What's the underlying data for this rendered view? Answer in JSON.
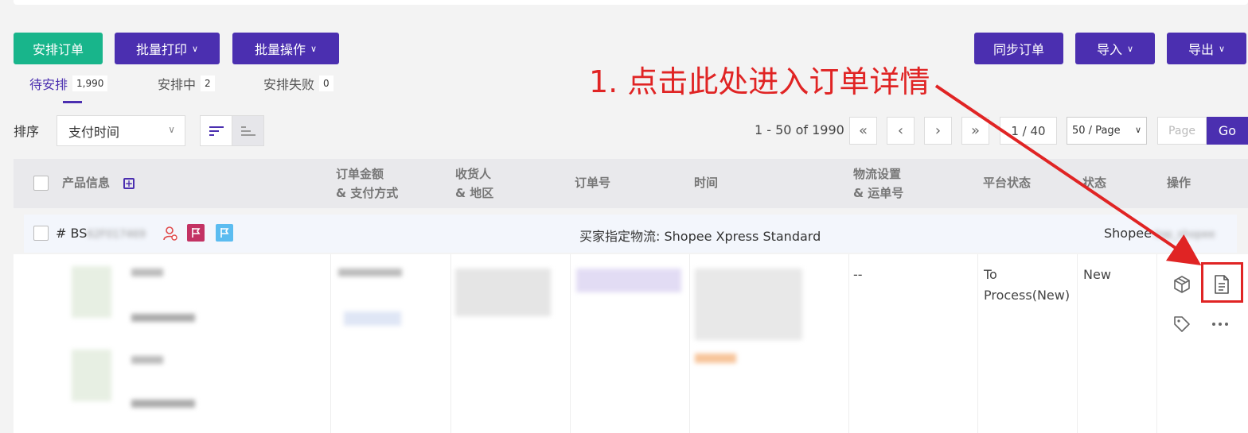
{
  "toolbar": {
    "arrange": "安排订单",
    "batch_print": "批量打印",
    "batch_ops": "批量操作",
    "sync": "同步订单",
    "import": "导入",
    "export": "导出"
  },
  "tabs": [
    {
      "label": "待安排",
      "count": "1,990"
    },
    {
      "label": "安排中",
      "count": "2"
    },
    {
      "label": "安排失败",
      "count": "0"
    }
  ],
  "sort": {
    "label": "排序",
    "value": "支付时间"
  },
  "pager": {
    "range": "1 - 50 of 1990",
    "current": "1 / 40",
    "page_size": "50 / Page",
    "page_placeholder": "Page",
    "go": "Go"
  },
  "table": {
    "headers": {
      "product": "产品信息",
      "amount_1": "订单金额",
      "amount_2": "& 支付方式",
      "receiver_1": "收货人",
      "receiver_2": "& 地区",
      "order_no": "订单号",
      "time": "时间",
      "logistics_1": "物流设置",
      "logistics_2": "& 运单号",
      "platform_status": "平台状态",
      "status": "状态",
      "actions": "操作"
    },
    "group": {
      "order_id": "# BS",
      "order_id_blurred": "62F017469",
      "logistics": "买家指定物流: Shopee Xpress Standard",
      "store": "Shopee",
      "store_blurred": "-top_shopee"
    },
    "row": {
      "logistics_value": "--",
      "platform_status_1": "To",
      "platform_status_2": "Process(New)",
      "status": "New"
    }
  },
  "annotation": {
    "text": "1. 点击此处进入订单详情"
  },
  "colors": {
    "accent": "#4b2fb0",
    "green": "#18b58b",
    "red": "#e02424"
  }
}
